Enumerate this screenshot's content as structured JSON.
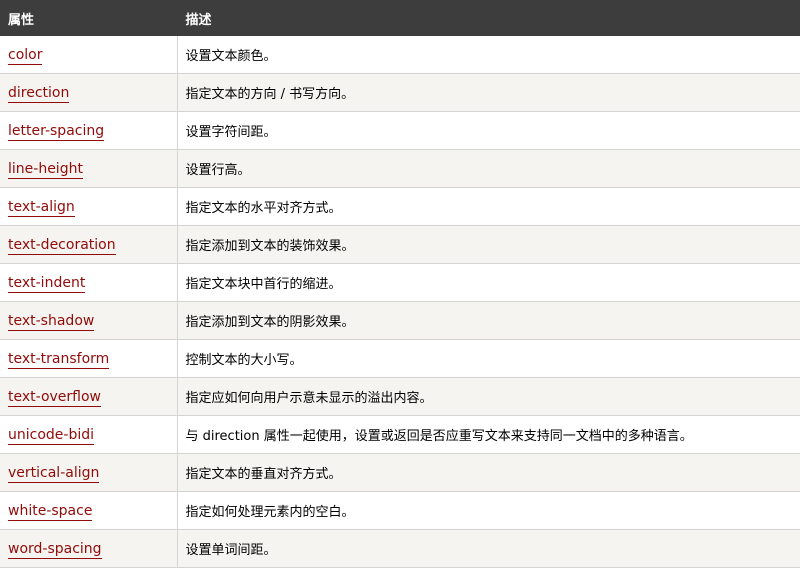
{
  "header": {
    "col_property": "属性",
    "col_description": "描述"
  },
  "rows": [
    {
      "property": "color",
      "description": "设置文本颜色。"
    },
    {
      "property": "direction",
      "description": "指定文本的方向 / 书写方向。"
    },
    {
      "property": "letter-spacing",
      "description": "设置字符间距。"
    },
    {
      "property": "line-height",
      "description": "设置行高。"
    },
    {
      "property": "text-align",
      "description": "指定文本的水平对齐方式。"
    },
    {
      "property": "text-decoration",
      "description": "指定添加到文本的装饰效果。"
    },
    {
      "property": "text-indent",
      "description": "指定文本块中首行的缩进。"
    },
    {
      "property": "text-shadow",
      "description": "指定添加到文本的阴影效果。"
    },
    {
      "property": "text-transform",
      "description": "控制文本的大小写。"
    },
    {
      "property": "text-overflow",
      "description": "指定应如何向用户示意未显示的溢出内容。"
    },
    {
      "property": "unicode-bidi",
      "description": "与 direction 属性一起使用，设置或返回是否应重写文本来支持同一文档中的多种语言。"
    },
    {
      "property": "vertical-align",
      "description": "指定文本的垂直对齐方式。"
    },
    {
      "property": "white-space",
      "description": "指定如何处理元素内的空白。"
    },
    {
      "property": "word-spacing",
      "description": "设置单词间距。"
    }
  ],
  "colors": {
    "header_bg": "#3d3d3d",
    "link": "#900b09",
    "row_alt_bg": "#f6f4f0",
    "border": "#d4d4d4"
  }
}
